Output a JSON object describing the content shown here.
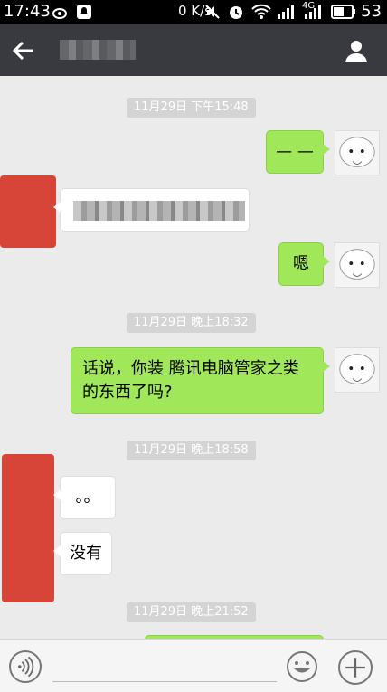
{
  "status_bar": {
    "time": "17:43",
    "net_speed": "0 K/s",
    "network": "4G",
    "battery": "53"
  },
  "messages": {
    "ts1": "11月29日 下午15:48",
    "m1": "— —",
    "m3": "嗯",
    "ts2": "11月29日 晚上18:32",
    "m4": "话说，你装 腾讯电脑管家之类的东西了吗?",
    "ts3": "11月29日 晚上18:58",
    "m5": "。。",
    "m6": "没有",
    "ts4": "11月29日 晚上21:52"
  },
  "colors": {
    "sent_bubble": "#a0e75a",
    "title_bar": "#393a3f",
    "avatar_red": "#d74438"
  }
}
